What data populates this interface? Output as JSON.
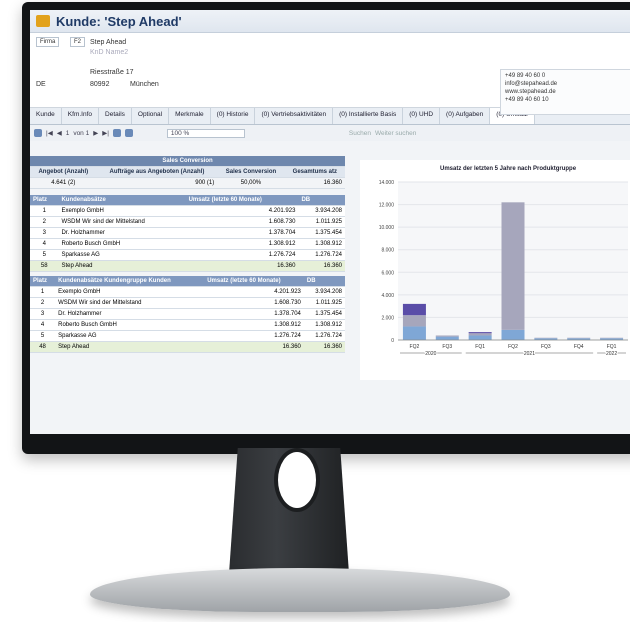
{
  "window": {
    "title": "Kunde: 'Step Ahead'"
  },
  "header": {
    "firma_label": "Firma",
    "firma_code": "F2",
    "name": "Step Ahead",
    "name2": "KnD Name2",
    "street": "Riesstraße 17",
    "country": "DE",
    "zip": "80992",
    "city": "München",
    "contact": {
      "phone": "+49 89 40 60 0",
      "email": "info@stepahead.de",
      "web": "www.stepahead.de",
      "fax": "+49 89 40 60 10"
    }
  },
  "tabs": [
    "Kunde",
    "Kfm.Info",
    "Details",
    "Optional",
    "Merkmale",
    "(0) Historie",
    "(0) Vertriebsaktivitäten",
    "(0) Installierte Basis",
    "(0) UHD",
    "(0) Aufgaben",
    "(0) Umsatz"
  ],
  "toolbar": {
    "page": "1",
    "of": "von 1",
    "zoom": "100 %",
    "search": "Suchen",
    "next": "Weiter suchen"
  },
  "sales_conversion": {
    "title": "Sales Conversion",
    "cols": [
      "Angebot (Anzahl)",
      "Aufträge aus Angeboten (Anzahl)",
      "Sales Conversion",
      "Gesamtums atz"
    ],
    "row": [
      "4.641 (2)",
      "900 (1)",
      "50,00%",
      "16.360"
    ]
  },
  "ranking1": {
    "cols": [
      "Platz",
      "Kundenabsätze",
      "Umsatz (letzte 60 Monate)",
      "DB"
    ],
    "rows": [
      [
        "1",
        "Exemplo GmbH",
        "4.201.923",
        "3.934.208"
      ],
      [
        "2",
        "WSDM Wir sind der Mittelstand",
        "1.608.730",
        "1.011.925"
      ],
      [
        "3",
        "Dr. Holzhammer",
        "1.378.704",
        "1.375.454"
      ],
      [
        "4",
        "Roberto Busch GmbH",
        "1.308.912",
        "1.308.912"
      ],
      [
        "5",
        "Sparkasse AG",
        "1.276.724",
        "1.276.724"
      ],
      [
        "58",
        "Step Ahead",
        "16.360",
        "16.360"
      ]
    ]
  },
  "ranking2": {
    "cols": [
      "Platz",
      "Kundenabsätze Kundengruppe Kunden",
      "Umsatz (letzte 60 Monate)",
      "DB"
    ],
    "rows": [
      [
        "1",
        "Exemplo GmbH",
        "4.201.923",
        "3.934.208"
      ],
      [
        "2",
        "WSDM Wir sind der Mittelstand",
        "1.608.730",
        "1.011.925"
      ],
      [
        "3",
        "Dr. Holzhammer",
        "1.378.704",
        "1.375.454"
      ],
      [
        "4",
        "Roberto Busch GmbH",
        "1.308.912",
        "1.308.912"
      ],
      [
        "5",
        "Sparkasse AG",
        "1.276.724",
        "1.276.724"
      ],
      [
        "48",
        "Step Ahead",
        "16.360",
        "16.360"
      ]
    ]
  },
  "chart_data": {
    "type": "bar",
    "title": "Umsatz der letzten 5 Jahre nach Produktgruppe",
    "categories": [
      "FQ2",
      "FQ3",
      "FQ1",
      "FQ2",
      "FQ3",
      "FQ4",
      "FQ1"
    ],
    "year_groups": [
      "2020",
      "2021",
      "2022"
    ],
    "ylim": [
      0,
      14000
    ],
    "yticks": [
      "0",
      "2.000",
      "4.000",
      "6.000",
      "8.000",
      "10.000",
      "12.000",
      "14.000"
    ],
    "series": [
      {
        "values": [
          1200,
          300,
          400,
          900,
          150,
          150,
          150
        ],
        "color": "#7fa7d6"
      },
      {
        "values": [
          1000,
          100,
          200,
          11300,
          50,
          50,
          50
        ],
        "color": "#a6a6bc"
      },
      {
        "values": [
          0,
          0,
          0,
          0,
          0,
          0,
          0
        ],
        "color": "#5a4da8"
      }
    ],
    "top_band": [
      1000,
      0,
      100,
      0,
      0,
      0,
      0
    ],
    "colors": {
      "top": "#5a4da8",
      "mid": "#a6a6bc",
      "base": "#7fa7d6"
    }
  }
}
